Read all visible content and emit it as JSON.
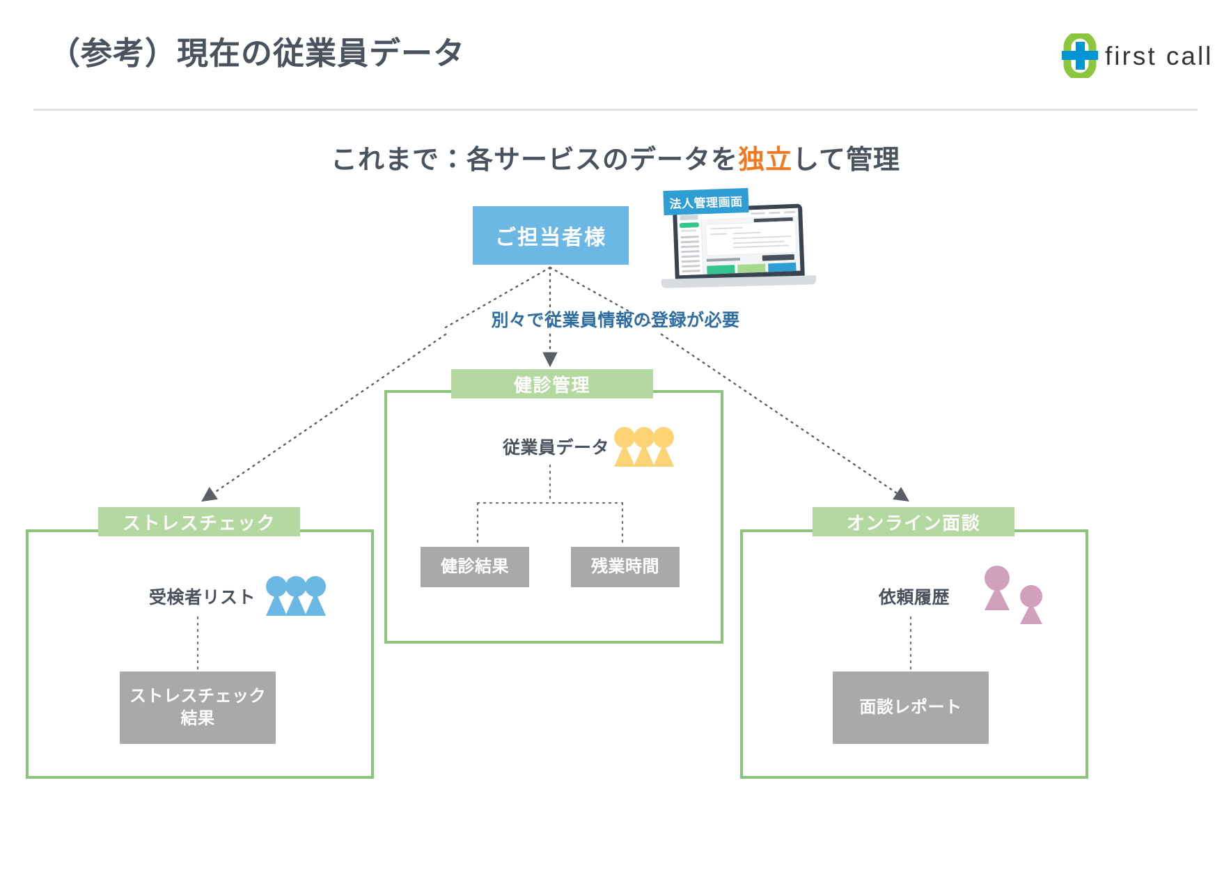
{
  "header": {
    "title": "（参考）現在の従業員データ",
    "brand": {
      "wordmark": "first call",
      "mark_green": "#8cc63f",
      "mark_blue": "#0096d6"
    }
  },
  "subtitle": {
    "prefix": "これまで：各サービスのデータを",
    "highlight": "独立",
    "suffix": "して管理",
    "highlight_color": "#f07a22"
  },
  "diagram": {
    "owner_node": {
      "label": "ご担当者様",
      "color": "#6ab8e3"
    },
    "laptop": {
      "badge": "法人管理画面",
      "badge_color": "#2f9ed4"
    },
    "note": {
      "text": "別々で従業員情報の登録が必要",
      "color": "#2e6da4"
    },
    "services": [
      {
        "key": "stress-check",
        "header": "ストレスチェック",
        "header_color": "#b3d9a0",
        "border_color": "#8cc479",
        "data_label": "受検者リスト",
        "people_icon": "people-group-icon",
        "people_color": "#6ab8e3",
        "people_count": 3,
        "tiles": [
          {
            "label_line1": "ストレスチェック",
            "label_line2": "結果",
            "color": "#a9a9a9"
          }
        ]
      },
      {
        "key": "kenshin-kanri",
        "header": "健診管理",
        "header_color": "#b3d9a0",
        "border_color": "#8cc479",
        "data_label": "従業員データ",
        "people_icon": "people-group-icon",
        "people_color": "#fcd375",
        "people_count": 3,
        "tiles": [
          {
            "label_line1": "健診結果",
            "label_line2": "",
            "color": "#a9a9a9"
          },
          {
            "label_line1": "残業時間",
            "label_line2": "",
            "color": "#a9a9a9"
          }
        ]
      },
      {
        "key": "online-mendan",
        "header": "オンライン面談",
        "header_color": "#b3d9a0",
        "border_color": "#8cc479",
        "data_label": "依頼履歴",
        "people_icon": "people-pair-icon",
        "people_color": "#d0a0bc",
        "people_count": 2,
        "tiles": [
          {
            "label_line1": "面談レポート",
            "label_line2": "",
            "color": "#a9a9a9"
          }
        ]
      }
    ]
  }
}
